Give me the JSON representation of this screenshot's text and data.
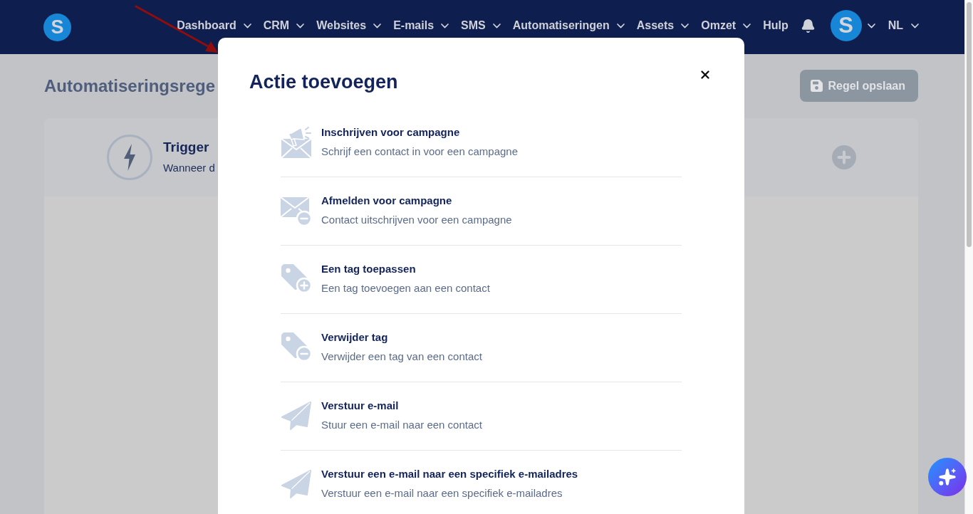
{
  "navbar": {
    "logo": "S",
    "menu": [
      {
        "label": "Dashboard",
        "dropdown": true
      },
      {
        "label": "CRM",
        "dropdown": true
      },
      {
        "label": "Websites",
        "dropdown": true
      },
      {
        "label": "E-mails",
        "dropdown": true
      },
      {
        "label": "SMS",
        "dropdown": true
      },
      {
        "label": "Automatiseringen",
        "dropdown": true
      },
      {
        "label": "Assets",
        "dropdown": true
      },
      {
        "label": "Omzet",
        "dropdown": true
      },
      {
        "label": "Hulp",
        "dropdown": false
      }
    ],
    "avatar": "S",
    "language": "NL"
  },
  "page": {
    "title": "Automatiseringsrege",
    "save_button": "Regel opslaan",
    "trigger": {
      "title": "Trigger",
      "description": "Wanneer d"
    }
  },
  "modal": {
    "title": "Actie toevoegen",
    "actions": [
      {
        "kind": "subscribe",
        "title": "Inschrijven voor campagne",
        "description": "Schrijf een contact in voor een campagne"
      },
      {
        "kind": "unsubscribe",
        "title": "Afmelden voor campagne",
        "description": "Contact uitschrijven voor een campagne"
      },
      {
        "kind": "addtag",
        "title": "Een tag toepassen",
        "description": "Een tag toevoegen aan een contact"
      },
      {
        "kind": "removetag",
        "title": "Verwijder tag",
        "description": "Verwijder een tag van een contact"
      },
      {
        "kind": "send",
        "title": "Verstuur e-mail",
        "description": "Stuur een e-mail naar een contact"
      },
      {
        "kind": "send",
        "title": "Verstuur een e-mail naar een specifiek e-mailadres",
        "description": "Verstuur een e-mail naar een specifiek e-mailadres"
      }
    ]
  }
}
